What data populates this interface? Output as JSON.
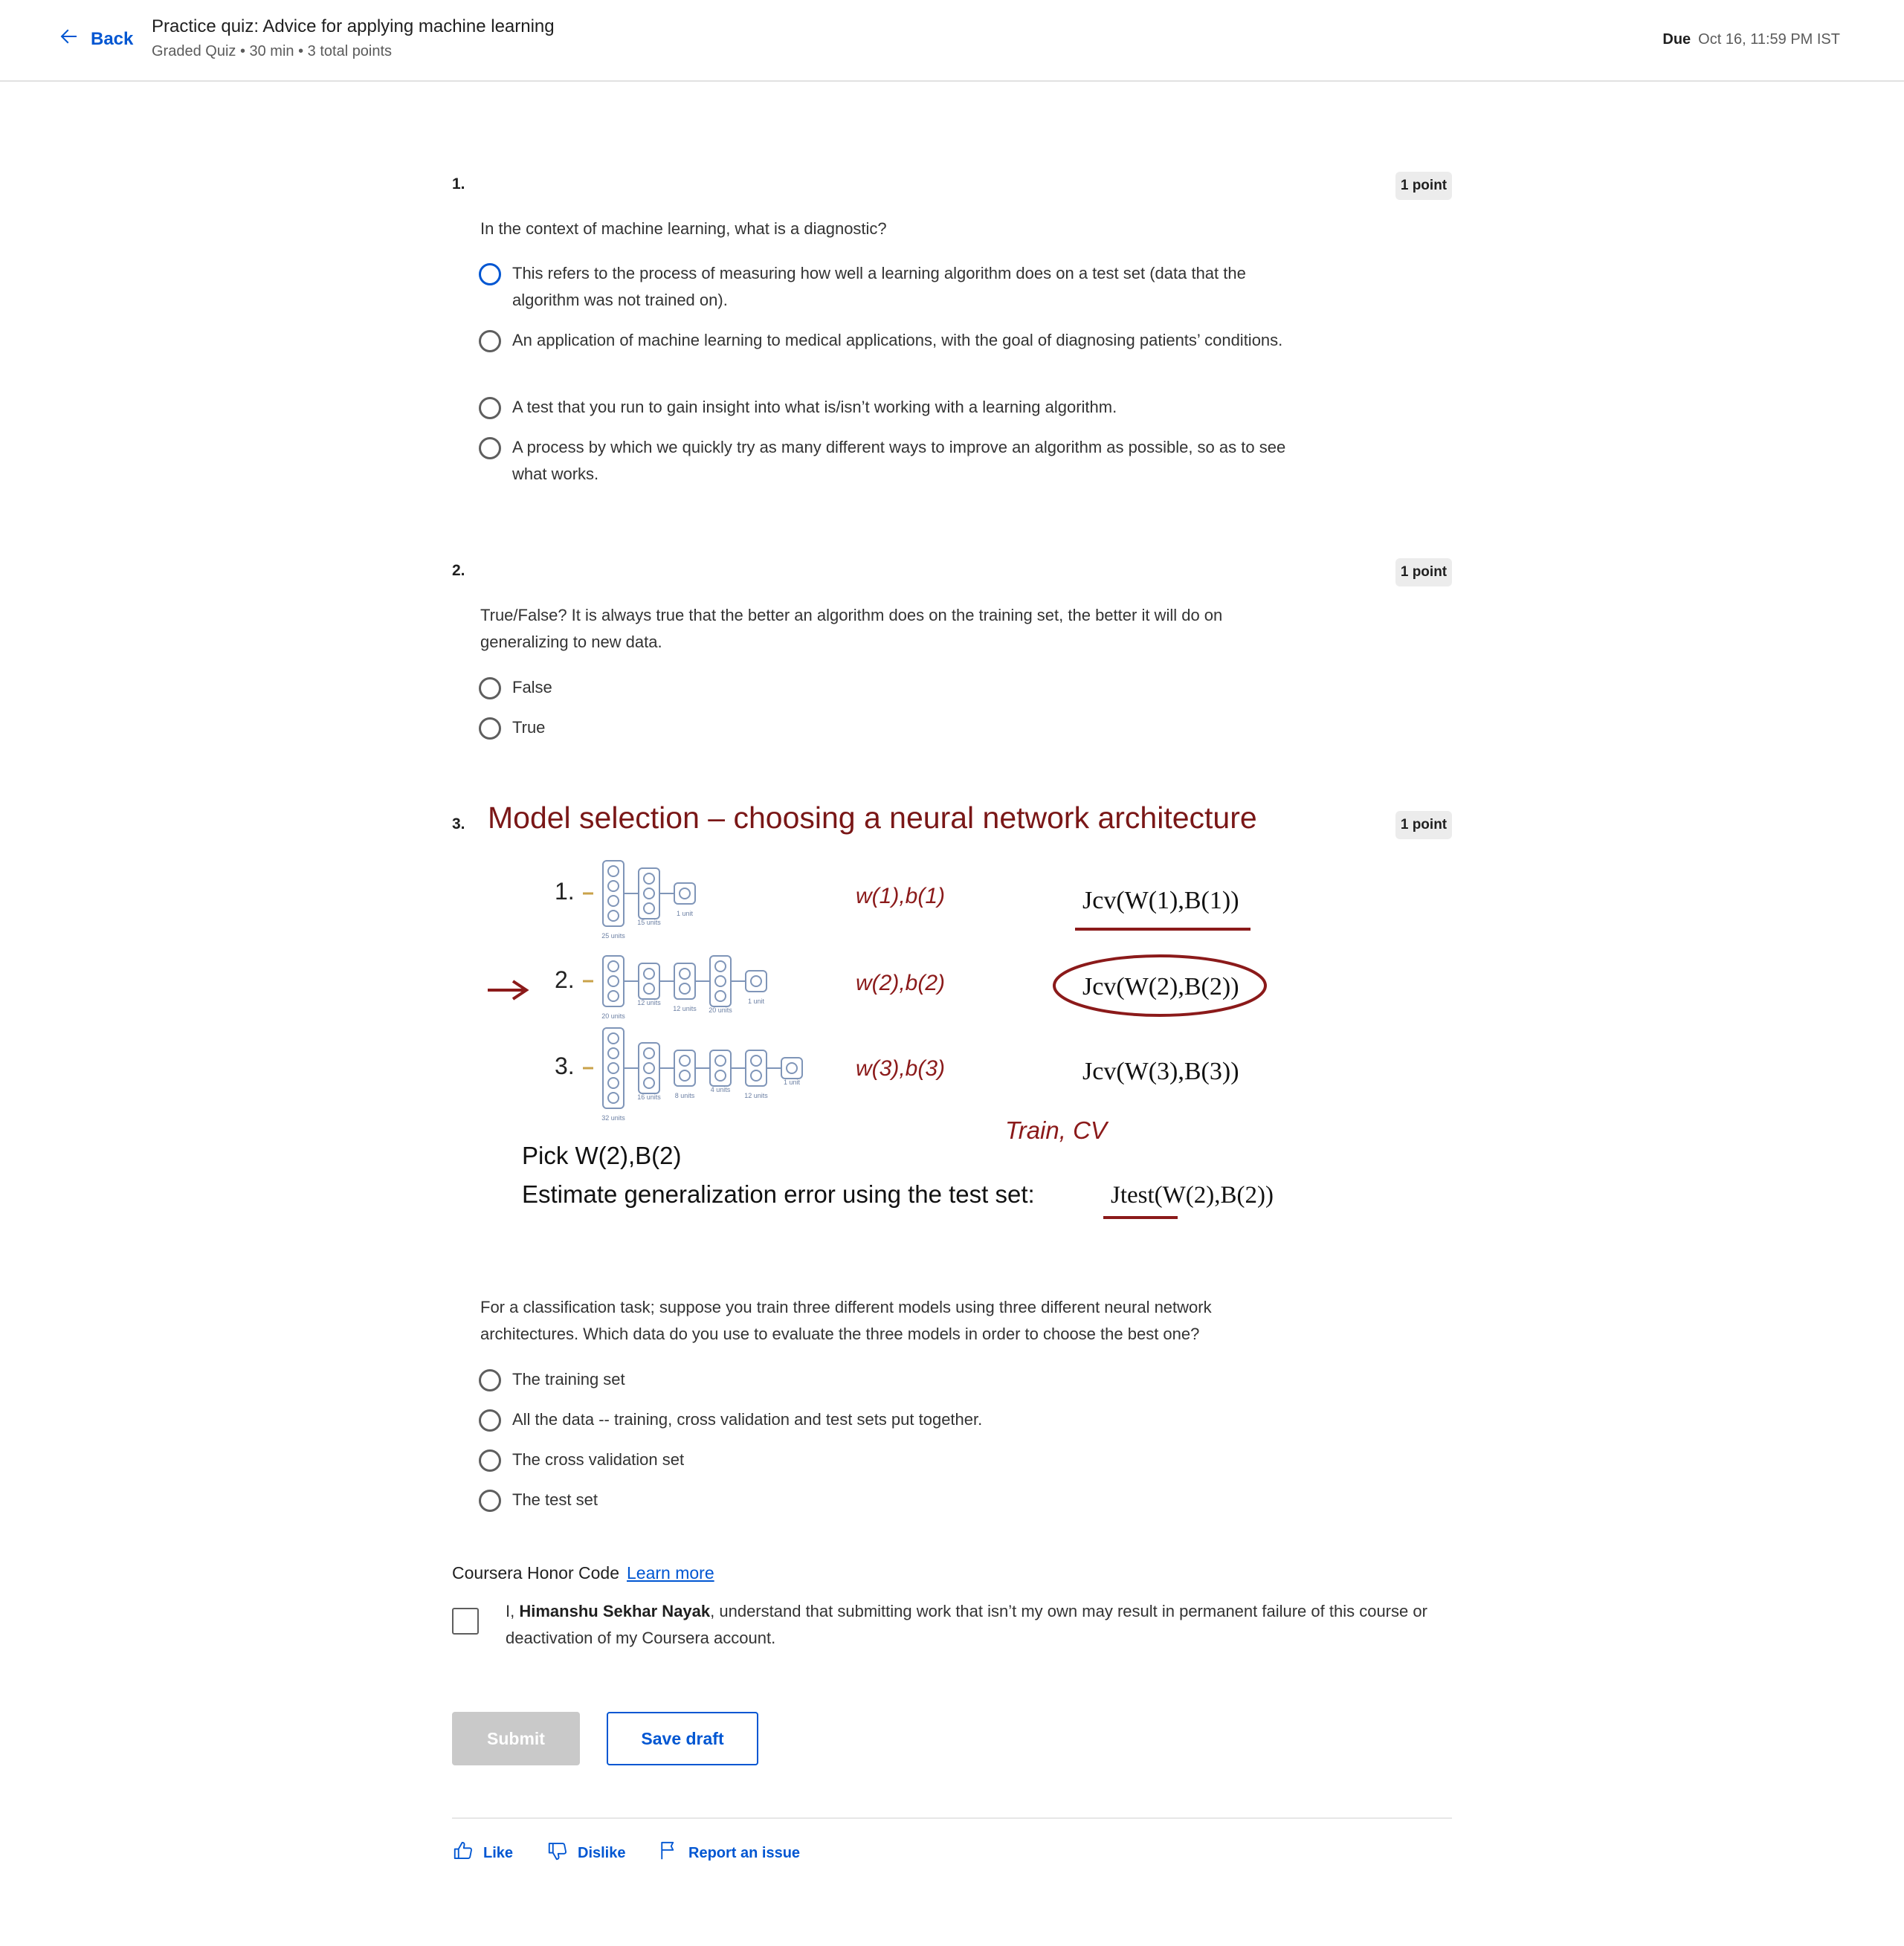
{
  "header": {
    "back_label": "Back",
    "title": "Practice quiz: Advice for applying machine learning",
    "subtitle": "Graded Quiz • 30 min • 3 total points",
    "due_label": "Due",
    "due_value": "Oct 16, 11:59 PM IST"
  },
  "questions": [
    {
      "number": "1.",
      "points": "1 point",
      "prompt": "In the context of machine learning, what is a diagnostic?",
      "options": [
        "This refers to the process of measuring how well a learning algorithm does on a test set (data that the algorithm was not trained on).",
        "An application of machine learning to medical applications, with the goal of diagnosing patients’ conditions.",
        "A test that you run to gain insight into what is/isn’t working with a learning algorithm.",
        "A process by which we quickly try as many different ways to improve an algorithm as possible, so as to see what works."
      ]
    },
    {
      "number": "2.",
      "points": "1 point",
      "prompt": "True/False? It is always true that the better an algorithm does on the training set, the better it will do on generalizing to new data.",
      "options": [
        "False",
        "True"
      ]
    },
    {
      "number": "3.",
      "points": "1 point",
      "prompt": "For a classification task; suppose you train three different models using three different neural network architectures. Which data do you use to evaluate the three models in order to choose the best one?",
      "options": [
        "The training set",
        "All the data -- training, cross validation and test sets put together.",
        "The cross validation set",
        "The test set"
      ],
      "figure": {
        "title": "Model selection – choosing a neural network architecture",
        "rows": [
          {
            "label": "1.",
            "params": "w(1),b(1)",
            "cost": "Jcv(W(1),B(1))",
            "units": [
              "25 units",
              "15 units",
              "1 unit"
            ]
          },
          {
            "label": "2.",
            "params": "w(2),b(2)",
            "cost": "Jcv(W(2),B(2))",
            "units": [
              "20 units",
              "12 units",
              "12 units",
              "20 units",
              "1 unit"
            ]
          },
          {
            "label": "3.",
            "params": "w(3),b(3)",
            "cost": "Jcv(W(3),B(3))",
            "units": [
              "32 units",
              "16 units",
              "8 units",
              "4 units",
              "12 units",
              "1 unit"
            ]
          }
        ],
        "annotation": "Train, CV",
        "pick_text": "Pick W(2),B(2)",
        "estimate_text": "Estimate generalization error using the test set:",
        "estimate_formula": "Jtest(W(2),B(2))",
        "ink_color": "#8b1a1a"
      }
    }
  ],
  "honor": {
    "title": "Coursera Honor Code",
    "learn_more": "Learn more",
    "text_prefix": "I,",
    "name": "Himanshu Sekhar Nayak",
    "text_suffix": ", understand that submitting work that isn’t my own may result in permanent failure of this course or deactivation of my Coursera account."
  },
  "actions": {
    "submit": "Submit",
    "save_draft": "Save draft"
  },
  "feedback": {
    "like": "Like",
    "dislike": "Dislike",
    "report": "Report an issue"
  },
  "colors": {
    "accent": "#0056d2",
    "disabled": "#c9c9c9"
  }
}
